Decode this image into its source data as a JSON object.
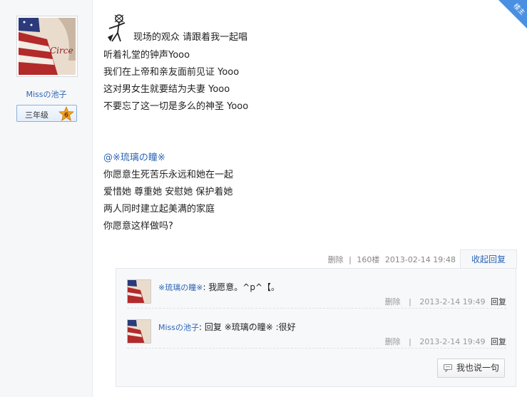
{
  "user": {
    "name": "Missの池子",
    "level_label": "三年级",
    "level_number": "6",
    "avatar_text": "Circe"
  },
  "corner_badge": "楼主",
  "post": {
    "lines": [
      "现场的观众 请跟着我一起唱",
      "听着礼堂的钟声Yooo",
      "我们在上帝和亲友面前见证 Yooo",
      "这对男女生就要结为夫妻 Yooo",
      "不要忘了这一切是多么的神圣 Yooo"
    ],
    "mention": "@※琉璃の瞳※",
    "lines2": [
      "你愿意生死苦乐永远和她在一起",
      "爱惜她 尊重她 安慰她 保护着她",
      "两人同时建立起美满的家庭",
      "你愿意这样做吗?"
    ]
  },
  "footer": {
    "delete_label": "删除",
    "separator": "|",
    "floor": "160楼",
    "timestamp": "2013-02-14 19:48",
    "collapse_label": "收起回复"
  },
  "replies": [
    {
      "name": "※琉璃の瞳※",
      "text": ": 我愿意。^p^【。",
      "delete_label": "删除",
      "separator": "|",
      "timestamp": "2013-2-14 19:49",
      "reply_label": "回复"
    },
    {
      "name": "Missの池子",
      "text": ": 回复 ※琉璃の瞳※ :很好",
      "delete_label": "删除",
      "separator": "|",
      "timestamp": "2013-2-14 19:49",
      "reply_label": "回复"
    }
  ],
  "say_button_label": "我也说一句",
  "colors": {
    "link": "#2d64b3",
    "badge": "#4a90e2"
  }
}
